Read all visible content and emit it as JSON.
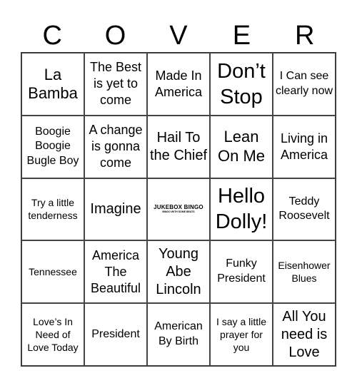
{
  "header": {
    "letters": [
      "C",
      "O",
      "V",
      "E",
      "R"
    ]
  },
  "free_space": {
    "line1": "JUKEBOX BINGO",
    "line2": "BINGO WITH SOME BEATS"
  },
  "cells": [
    "La Bamba",
    "The Best is yet to come",
    "Made In America",
    "Don’t Stop",
    "I Can see clearly now",
    "Boogie Boogie Bugle Boy",
    "A change is gonna come",
    "Hail To the Chief",
    "Lean On Me",
    "Living in America",
    "Try a little tenderness",
    "Imagine",
    "",
    "Hello Dolly!",
    "Teddy Roosevelt",
    "Tennessee",
    "America The Beautiful",
    "Young Abe Lincoln",
    "Funky President",
    "Eisenhower Blues",
    "Love’s In Need of Love Today",
    "President",
    "American By Birth",
    "I say a little prayer for you",
    "All You need is Love"
  ]
}
